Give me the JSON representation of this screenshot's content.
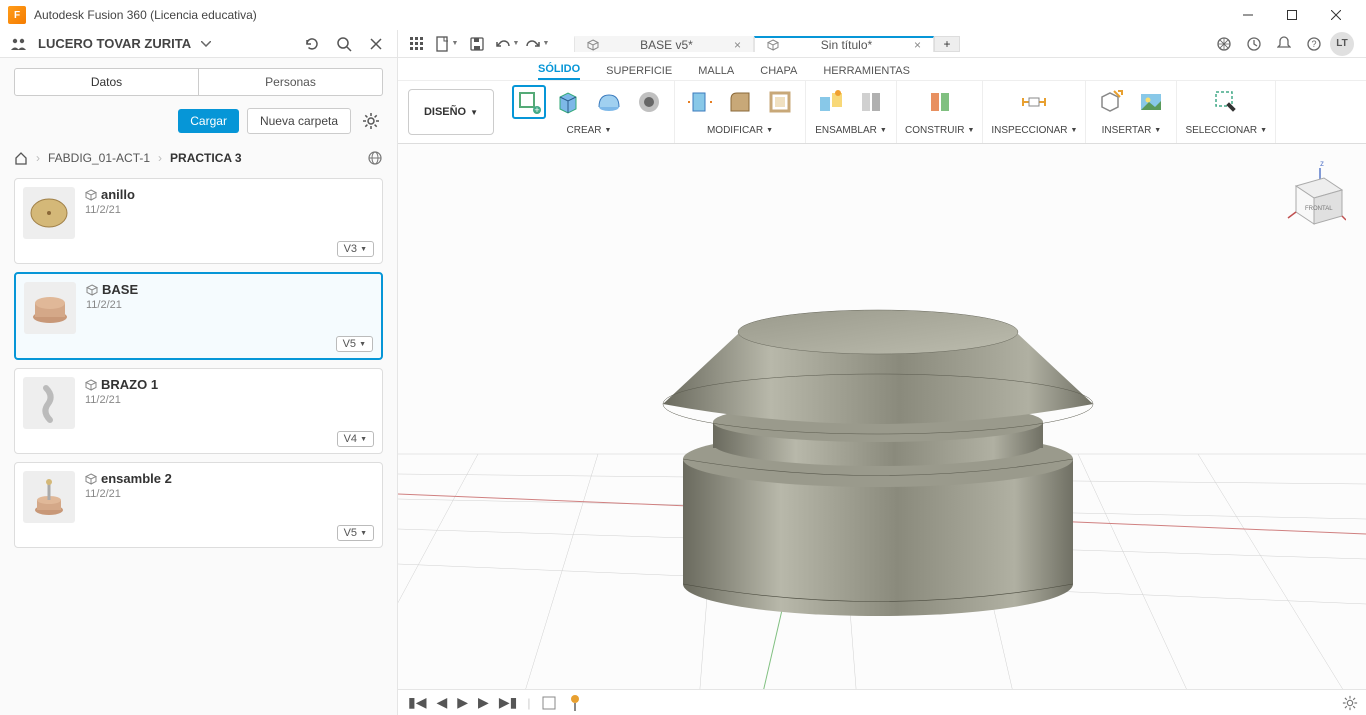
{
  "window": {
    "title": "Autodesk Fusion 360 (Licencia educativa)",
    "app_icon_text": "F"
  },
  "project": {
    "name": "LUCERO TOVAR ZURITA"
  },
  "doc_tabs": [
    {
      "label": "BASE v5*",
      "active": false
    },
    {
      "label": "Sin título*",
      "active": true
    }
  ],
  "user": {
    "initials": "LT"
  },
  "side_panel": {
    "tabs": {
      "data": "Datos",
      "people": "Personas"
    },
    "buttons": {
      "upload": "Cargar",
      "new_folder": "Nueva carpeta"
    },
    "breadcrumb": {
      "level1": "FABDIG_01-ACT-1",
      "level2": "PRACTICA 3"
    },
    "files": [
      {
        "name": "anillo",
        "date": "11/2/21",
        "version": "V3",
        "selected": false
      },
      {
        "name": "BASE",
        "date": "11/2/21",
        "version": "V5",
        "selected": true
      },
      {
        "name": "BRAZO 1",
        "date": "11/2/21",
        "version": "V4",
        "selected": false
      },
      {
        "name": "ensamble 2",
        "date": "11/2/21",
        "version": "V5",
        "selected": false
      }
    ]
  },
  "ribbon": {
    "design_label": "DISEÑO",
    "tabs": {
      "solid": "SÓLIDO",
      "surface": "SUPERFICIE",
      "mesh": "MALLA",
      "sheet": "CHAPA",
      "tools": "HERRAMIENTAS"
    },
    "groups": {
      "create": "CREAR",
      "modify": "MODIFICAR",
      "assemble": "ENSAMBLAR",
      "construct": "CONSTRUIR",
      "inspect": "INSPECCIONAR",
      "insert": "INSERTAR",
      "select": "SELECCIONAR"
    }
  },
  "viewcube": {
    "front": "FRONTAL",
    "z": "z"
  }
}
